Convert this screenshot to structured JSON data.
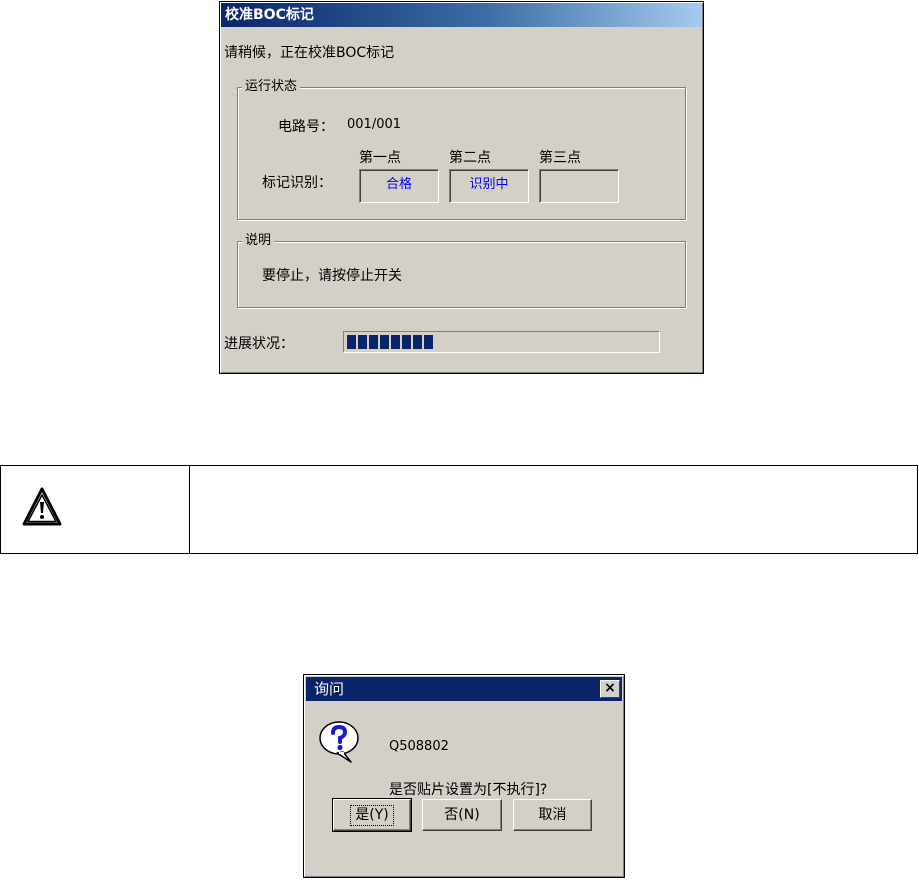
{
  "calibration_dialog": {
    "title": "校准BOC标记",
    "message": "请稍候，正在校准BOC标记",
    "run_status": {
      "legend": "运行状态",
      "circuit_label": "电路号：",
      "circuit_value": "001/001",
      "mark_label": "标记识别：",
      "points": [
        {
          "header": "第一点",
          "value": "合格"
        },
        {
          "header": "第二点",
          "value": "识别中"
        },
        {
          "header": "第三点",
          "value": ""
        }
      ]
    },
    "description": {
      "legend": "说明",
      "text": "要停止，请按停止开关"
    },
    "progress": {
      "label": "进展状况：",
      "segments_filled": 8,
      "fraction": 0.3
    }
  },
  "warning_box": {
    "icon": "warning-triangle-icon",
    "text": ""
  },
  "question_dialog": {
    "title": "询问",
    "close_label": "×",
    "icon": "question-balloon-icon",
    "code": "Q508802",
    "question": "是否贴片设置为[不执行]?",
    "buttons": {
      "yes": "是(Y)",
      "no": "否(N)",
      "cancel": "取消"
    }
  },
  "colors": {
    "dialog_face": "#d4d0c8",
    "title_dark": "#0a246a",
    "title_light": "#a6caf0",
    "status_text": "#0000ff",
    "progress_fill": "#0a246a"
  }
}
